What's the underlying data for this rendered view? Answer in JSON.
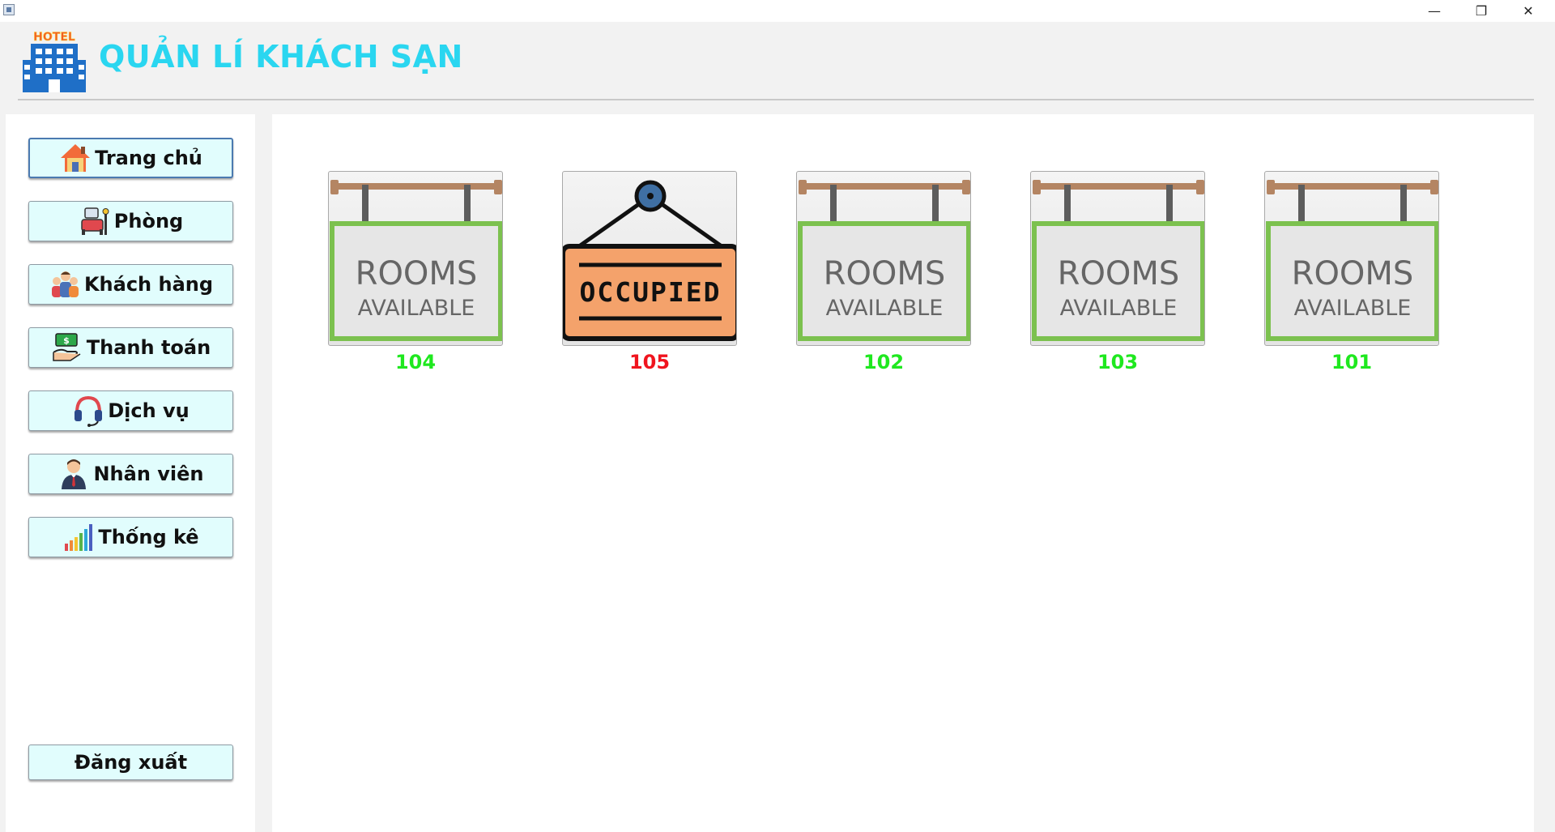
{
  "window": {
    "minimize_glyph": "—",
    "restore_glyph": "❐",
    "close_glyph": "✕"
  },
  "header": {
    "logo_text": "HOTEL",
    "title": "QUẢN LÍ KHÁCH SẠN",
    "title_color": "#2ad6f0"
  },
  "sidebar": {
    "items": [
      {
        "label": "Trang chủ",
        "icon": "house-icon",
        "active": true
      },
      {
        "label": "Phòng",
        "icon": "room-icon"
      },
      {
        "label": "Khách hàng",
        "icon": "customers-icon"
      },
      {
        "label": "Thanh toán",
        "icon": "payment-icon"
      },
      {
        "label": "Dịch vụ",
        "icon": "headset-icon"
      },
      {
        "label": "Nhân viên",
        "icon": "employee-icon"
      },
      {
        "label": "Thống kê",
        "icon": "chart-icon"
      }
    ],
    "logout_label": "Đăng xuất",
    "button_bg": "#e1fdfd"
  },
  "rooms": [
    {
      "number": "104",
      "status": "available",
      "sign_line1": "ROOMS",
      "sign_line2": "AVAILABLE"
    },
    {
      "number": "105",
      "status": "occupied",
      "sign_line1": "OCCUPIED"
    },
    {
      "number": "102",
      "status": "available",
      "sign_line1": "ROOMS",
      "sign_line2": "AVAILABLE"
    },
    {
      "number": "103",
      "status": "available",
      "sign_line1": "ROOMS",
      "sign_line2": "AVAILABLE"
    },
    {
      "number": "101",
      "status": "available",
      "sign_line1": "ROOMS",
      "sign_line2": "AVAILABLE"
    }
  ],
  "colors": {
    "available": "#1fe81f",
    "occupied": "#f0141e",
    "sign_green": "#7cc14f",
    "sign_orange": "#f4a26b"
  }
}
